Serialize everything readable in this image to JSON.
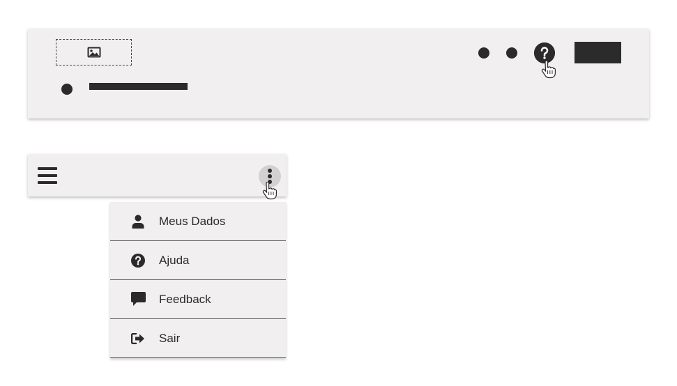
{
  "desktop_header": {
    "logo_icon": "image-icon",
    "help_icon": "question-circle-icon",
    "cursor_icon": "hand-pointer-icon"
  },
  "mobile_header": {
    "menu_icon": "hamburger-icon",
    "more_icon": "kebab-vertical-icon",
    "cursor_icon": "hand-pointer-icon"
  },
  "dropdown_menu": {
    "items": [
      {
        "label": "Meus Dados",
        "icon": "user-icon"
      },
      {
        "label": "Ajuda",
        "icon": "question-circle-icon"
      },
      {
        "label": "Feedback",
        "icon": "comment-icon"
      },
      {
        "label": "Sair",
        "icon": "sign-out-icon"
      }
    ]
  },
  "colors": {
    "surface": "#f1eff0",
    "ink": "#2b2b2b",
    "kebab_hover": "#d2d0d1"
  }
}
